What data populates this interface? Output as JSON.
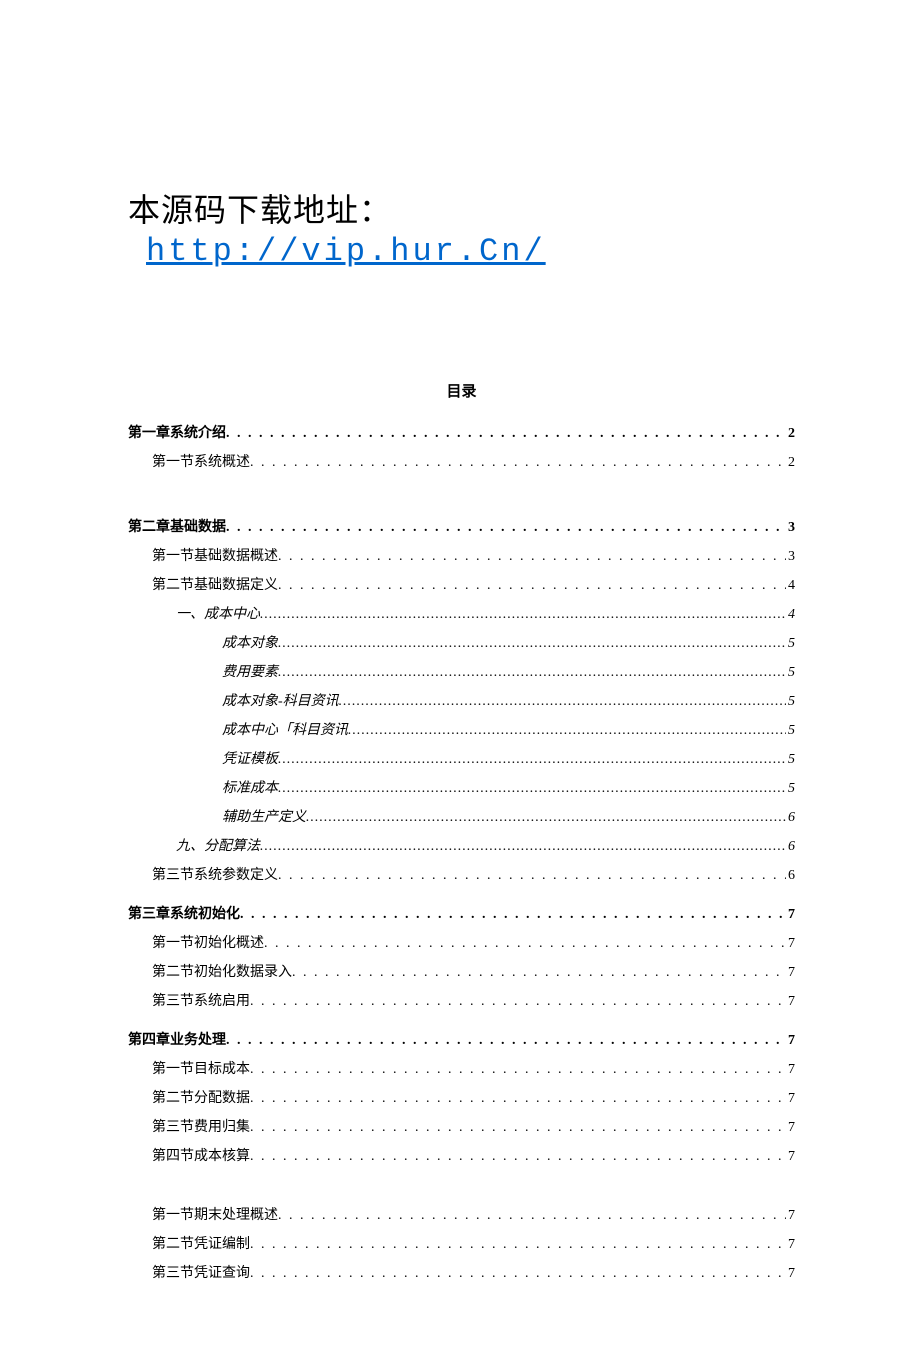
{
  "header": {
    "label": "本源码下载地址：",
    "link": "http://vip.hur.Cn/"
  },
  "toc_title": "目录",
  "toc": [
    {
      "label": "第一章系统介绍",
      "page": "2",
      "level": 1,
      "name": "ch1"
    },
    {
      "label": "第一节系统概述",
      "page": "2",
      "level": 2,
      "name": "ch1-s1",
      "extraClass": "gap-after-ch1"
    },
    {
      "label": "第二章基础数据",
      "page": "3",
      "level": 1,
      "name": "ch2"
    },
    {
      "label": "第一节基础数据概述",
      "page": "3",
      "level": 2,
      "name": "ch2-s1"
    },
    {
      "label": "第二节基础数据定义",
      "page": "4",
      "level": 2,
      "name": "ch2-s2"
    },
    {
      "label": "一、成本中心",
      "page": "4",
      "level": 3,
      "name": "ch2-s2-1",
      "dense": true
    },
    {
      "label": "成本对象",
      "page": "5",
      "level": 4,
      "name": "ch2-s2-2",
      "dense": true
    },
    {
      "label": "费用要素",
      "page": "5",
      "level": 4,
      "name": "ch2-s2-3",
      "dense": true
    },
    {
      "label": "成本对象-科目资讯",
      "page": "5",
      "level": 4,
      "name": "ch2-s2-4",
      "dense": true
    },
    {
      "label": "成本中心「科目资讯",
      "page": "5",
      "level": 4,
      "name": "ch2-s2-5",
      "dense": true
    },
    {
      "label": "凭证模板",
      "page": "5",
      "level": 4,
      "name": "ch2-s2-6",
      "dense": true
    },
    {
      "label": "标准成本",
      "page": "5",
      "level": 4,
      "name": "ch2-s2-7",
      "dense": true
    },
    {
      "label": "辅助生产定义",
      "page": "6",
      "level": 4,
      "name": "ch2-s2-8",
      "dense": true
    },
    {
      "label": "九、分配算法",
      "page": "6",
      "level": 3,
      "name": "ch2-s2-9",
      "dense": true
    },
    {
      "label": "第三节系统参数定义",
      "page": "6",
      "level": 2,
      "name": "ch2-s3"
    },
    {
      "label": "第三章系统初始化",
      "page": "7",
      "level": 1,
      "name": "ch3",
      "extraClass": "gap-before"
    },
    {
      "label": "第一节初始化概述",
      "page": "7",
      "level": 2,
      "name": "ch3-s1"
    },
    {
      "label": "第二节初始化数据录入",
      "page": "7",
      "level": 2,
      "name": "ch3-s2"
    },
    {
      "label": "第三节系统启用",
      "page": "7",
      "level": 2,
      "name": "ch3-s3"
    },
    {
      "label": "第四章业务处理",
      "page": "7",
      "level": 1,
      "name": "ch4",
      "extraClass": "gap-before"
    },
    {
      "label": "第一节目标成本",
      "page": "7",
      "level": 2,
      "name": "ch4-s1"
    },
    {
      "label": "第二节分配数据",
      "page": "7",
      "level": 2,
      "name": "ch4-s2"
    },
    {
      "label": "第三节费用归集",
      "page": "7",
      "level": 2,
      "name": "ch4-s3"
    },
    {
      "label": "第四节成本核算",
      "page": "7",
      "level": 2,
      "name": "ch4-s4"
    },
    {
      "label": "第一节期末处理概述",
      "page": "7",
      "level": 2,
      "name": "ch5-s1",
      "extraClass": "gap-large"
    },
    {
      "label": "第二节凭证编制",
      "page": "7",
      "level": 2,
      "name": "ch5-s2"
    },
    {
      "label": "第三节凭证查询",
      "page": "7",
      "level": 2,
      "name": "ch5-s3"
    }
  ]
}
